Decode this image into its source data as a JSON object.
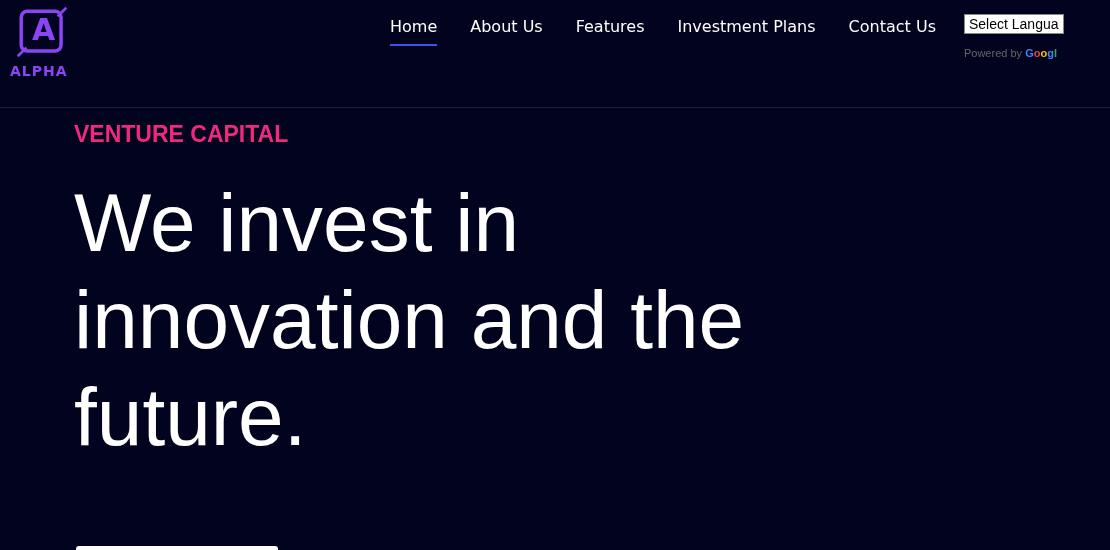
{
  "logo": {
    "letter": "A",
    "name": "ALPHA"
  },
  "nav": [
    {
      "label": "Home",
      "selected": true
    },
    {
      "label": "About Us",
      "selected": false
    },
    {
      "label": "Features",
      "selected": false
    },
    {
      "label": "Investment Plans",
      "selected": false
    },
    {
      "label": "Contact Us",
      "selected": false
    }
  ],
  "translate": {
    "select": "Select Langua",
    "powered_by": "Powered by",
    "brand": "Googl"
  },
  "hero": {
    "eyebrow": "VENTURE CAPITAL",
    "headline": "We invest in innovation and the future."
  }
}
